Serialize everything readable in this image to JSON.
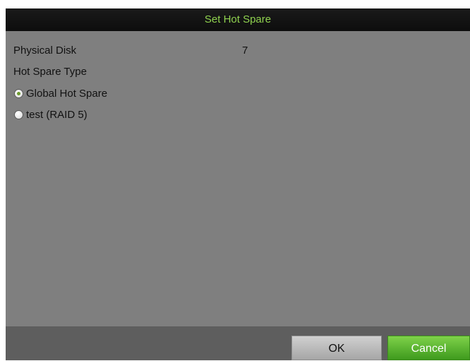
{
  "dialog": {
    "title": "Set Hot Spare",
    "physical_disk_label": "Physical Disk",
    "physical_disk_value": "7",
    "hot_spare_type_label": "Hot Spare Type",
    "options": [
      {
        "label": "Global Hot Spare",
        "selected": true
      },
      {
        "label": "test (RAID 5)",
        "selected": false
      }
    ]
  },
  "footer": {
    "ok_label": "OK",
    "cancel_label": "Cancel"
  },
  "colors": {
    "title_text": "#8fd14f",
    "title_bar": "#111111",
    "panel": "#7f7f7f",
    "footer": "#5e5e5e",
    "cancel_button": "#4fae2a"
  }
}
